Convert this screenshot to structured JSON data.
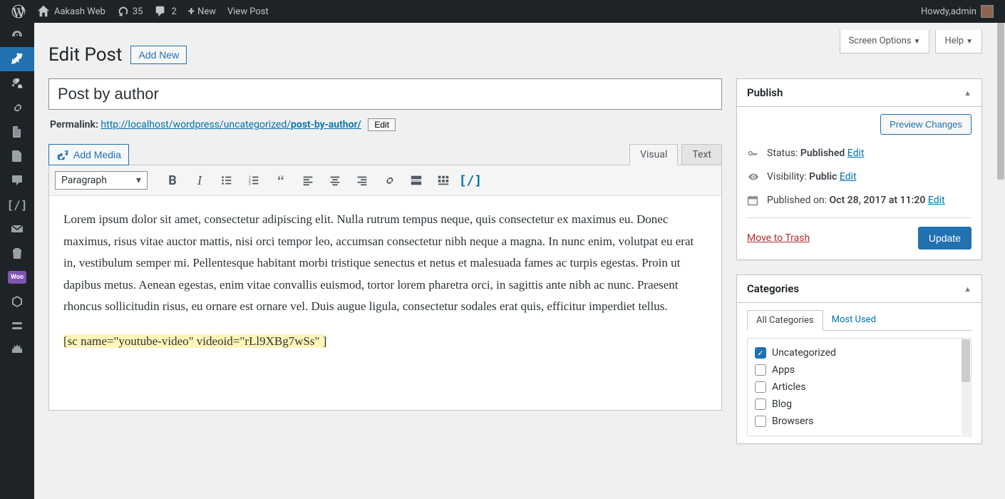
{
  "toolbar": {
    "site_name": "Aakash Web",
    "updates_count": "35",
    "comments_count": "2",
    "new_label": "New",
    "view_post_label": "View Post",
    "howdy_prefix": "Howdy, ",
    "user_name": "admin"
  },
  "header_buttons": {
    "screen_options": "Screen Options",
    "help": "Help"
  },
  "page_title": "Edit Post",
  "add_new_label": "Add New",
  "post_title": "Post by author",
  "permalink": {
    "label": "Permalink: ",
    "base_url": "http://localhost/wordpress/uncategorized/",
    "slug": "post-by-author/",
    "edit_label": "Edit"
  },
  "editor": {
    "add_media": "Add Media",
    "tab_visual": "Visual",
    "tab_text": "Text",
    "format_select": "Paragraph",
    "body_paragraph": "Lorem ipsum dolor sit amet, consectetur adipiscing elit. Nulla rutrum tempus neque, quis consectetur ex maximus eu. Donec maximus, risus vitae auctor mattis, nisi orci tempor leo, accumsan consectetur nibh neque a magna. In nunc enim, volutpat eu erat in, vestibulum semper mi. Pellentesque habitant morbi tristique senectus et netus et malesuada fames ac turpis egestas. Proin ut dapibus metus. Aenean egestas, enim vitae convallis euismod, tortor lorem pharetra orci, in sagittis ante nibh ac nunc. Praesent rhoncus sollicitudin risus, eu ornare est ornare vel. Duis augue ligula, consectetur sodales erat quis, efficitur imperdiet tellus.",
    "shortcode_text": "[sc name=\"youtube-video\" videoid=\"rLl9XBg7wSs\" ]"
  },
  "publish": {
    "title": "Publish",
    "preview_changes": "Preview Changes",
    "status_label": "Status: ",
    "status_value": "Published",
    "visibility_label": "Visibility: ",
    "visibility_value": "Public",
    "published_label": "Published on: ",
    "published_value": "Oct 28, 2017 at 11:20",
    "edit_link": "Edit",
    "move_to_trash": "Move to Trash",
    "update_label": "Update"
  },
  "categories": {
    "title": "Categories",
    "tab_all": "All Categories",
    "tab_most_used": "Most Used",
    "items": [
      {
        "label": "Uncategorized",
        "checked": true
      },
      {
        "label": "Apps",
        "checked": false
      },
      {
        "label": "Articles",
        "checked": false
      },
      {
        "label": "Blog",
        "checked": false
      },
      {
        "label": "Browsers",
        "checked": false
      }
    ]
  }
}
